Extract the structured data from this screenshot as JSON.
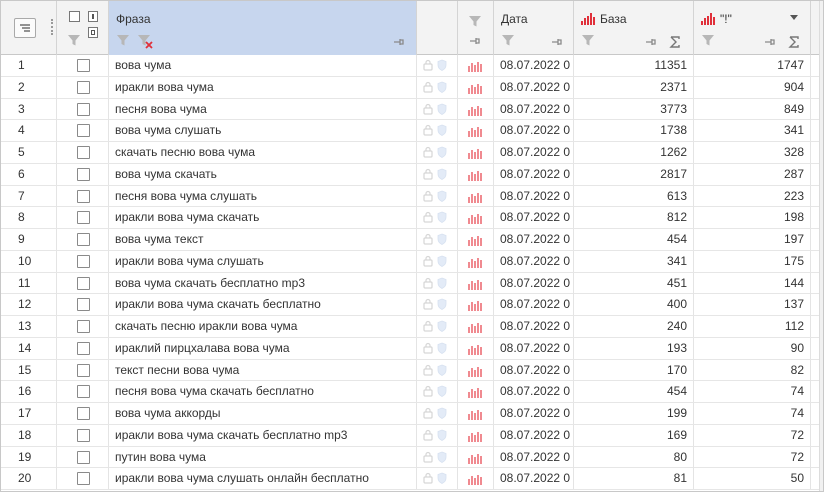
{
  "header": {
    "phrase": "Фраза",
    "date": "Дата",
    "base": "База",
    "excl": "\"!\""
  },
  "colors": {
    "selected_header": "#c7d6ee",
    "bars": "#e0303a",
    "filter": "#a9a9a9"
  },
  "icons": [
    "column-settings-icon",
    "select-all-checkbox-icon",
    "filter-icon",
    "clear-filter-icon",
    "pin-icon",
    "sum-icon",
    "lock-icon",
    "shield-icon",
    "bar-chart-icon",
    "sort-dropdown-icon"
  ],
  "rows": [
    {
      "n": "1",
      "phrase": "вова чума",
      "date": "08.07.2022 0",
      "base": "11351",
      "excl": "1747"
    },
    {
      "n": "2",
      "phrase": "иракли вова чума",
      "date": "08.07.2022 0",
      "base": "2371",
      "excl": "904"
    },
    {
      "n": "3",
      "phrase": "песня вова чума",
      "date": "08.07.2022 0",
      "base": "3773",
      "excl": "849"
    },
    {
      "n": "4",
      "phrase": "вова чума слушать",
      "date": "08.07.2022 0",
      "base": "1738",
      "excl": "341"
    },
    {
      "n": "5",
      "phrase": "скачать песню вова чума",
      "date": "08.07.2022 0",
      "base": "1262",
      "excl": "328"
    },
    {
      "n": "6",
      "phrase": "вова чума скачать",
      "date": "08.07.2022 0",
      "base": "2817",
      "excl": "287"
    },
    {
      "n": "7",
      "phrase": "песня вова чума слушать",
      "date": "08.07.2022 0",
      "base": "613",
      "excl": "223"
    },
    {
      "n": "8",
      "phrase": "иракли вова чума скачать",
      "date": "08.07.2022 0",
      "base": "812",
      "excl": "198"
    },
    {
      "n": "9",
      "phrase": "вова чума текст",
      "date": "08.07.2022 0",
      "base": "454",
      "excl": "197"
    },
    {
      "n": "10",
      "phrase": "иракли вова чума слушать",
      "date": "08.07.2022 0",
      "base": "341",
      "excl": "175"
    },
    {
      "n": "11",
      "phrase": "вова чума скачать бесплатно mp3",
      "date": "08.07.2022 0",
      "base": "451",
      "excl": "144"
    },
    {
      "n": "12",
      "phrase": "иракли вова чума скачать бесплатно",
      "date": "08.07.2022 0",
      "base": "400",
      "excl": "137"
    },
    {
      "n": "13",
      "phrase": "скачать песню иракли вова чума",
      "date": "08.07.2022 0",
      "base": "240",
      "excl": "112"
    },
    {
      "n": "14",
      "phrase": "ираклий пирцхалава вова чума",
      "date": "08.07.2022 0",
      "base": "193",
      "excl": "90"
    },
    {
      "n": "15",
      "phrase": "текст песни вова чума",
      "date": "08.07.2022 0",
      "base": "170",
      "excl": "82"
    },
    {
      "n": "16",
      "phrase": "песня вова чума скачать бесплатно",
      "date": "08.07.2022 0",
      "base": "454",
      "excl": "74"
    },
    {
      "n": "17",
      "phrase": "вова чума аккорды",
      "date": "08.07.2022 0",
      "base": "199",
      "excl": "74"
    },
    {
      "n": "18",
      "phrase": "иракли вова чума скачать бесплатно mp3",
      "date": "08.07.2022 0",
      "base": "169",
      "excl": "72"
    },
    {
      "n": "19",
      "phrase": "путин вова чума",
      "date": "08.07.2022 0",
      "base": "80",
      "excl": "72"
    },
    {
      "n": "20",
      "phrase": "иракли вова чума слушать онлайн бесплатно",
      "date": "08.07.2022 0",
      "base": "81",
      "excl": "50"
    }
  ]
}
